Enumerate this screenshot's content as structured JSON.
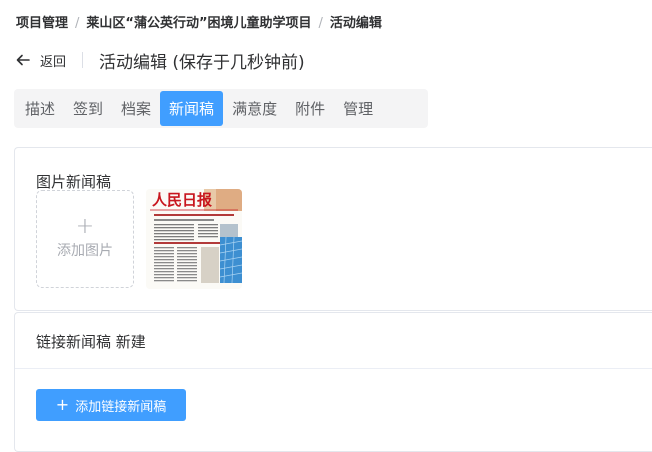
{
  "breadcrumb": {
    "items": [
      "项目管理",
      "莱山区“蒲公英行动”困境儿童助学项目",
      "活动编辑"
    ],
    "separator": "/"
  },
  "header": {
    "back_label": "返回",
    "title": "活动编辑 (保存于几秒钟前)"
  },
  "tabs": [
    {
      "label": "描述",
      "active": false
    },
    {
      "label": "签到",
      "active": false
    },
    {
      "label": "档案",
      "active": false
    },
    {
      "label": "新闻稿",
      "active": true
    },
    {
      "label": "满意度",
      "active": false
    },
    {
      "label": "附件",
      "active": false
    },
    {
      "label": "管理",
      "active": false
    }
  ],
  "image_news": {
    "title": "图片新闻稿",
    "upload_plus": "+",
    "upload_label": "添加图片",
    "thumbnail_masthead": "人民日报"
  },
  "link_news": {
    "title": "链接新闻稿 新建",
    "add_plus": "+",
    "add_button_label": "添加链接新闻稿"
  },
  "colors": {
    "accent": "#409eff",
    "tab_bg": "#f4f4f5",
    "masthead_red": "#c8161e"
  }
}
